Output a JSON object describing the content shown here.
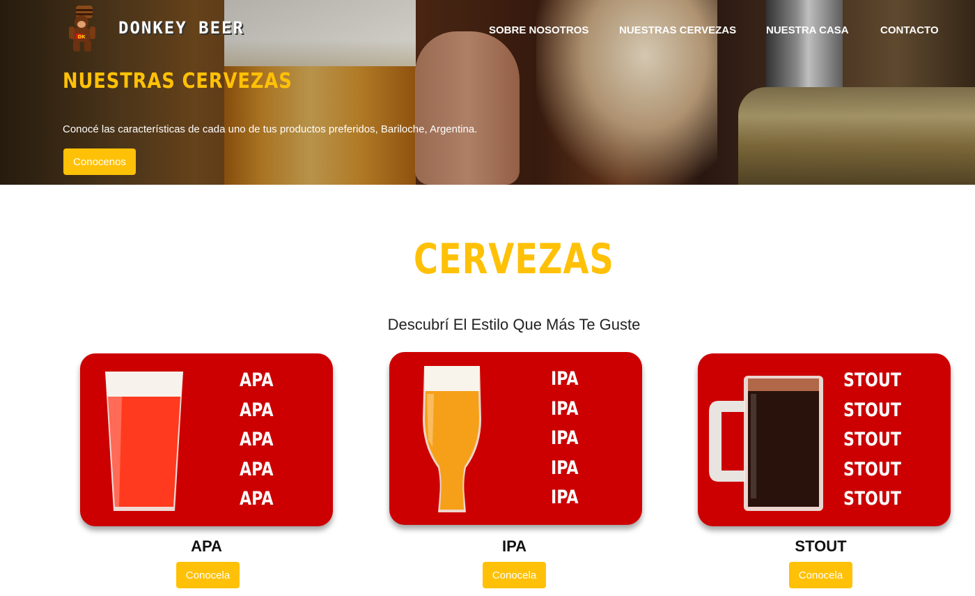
{
  "header": {
    "brand": "DONKEY BEER",
    "nav": [
      "SOBRE NOSOTROS",
      "NUESTRAS CERVEZAS",
      "NUESTRA CASA",
      "CONTACTO"
    ]
  },
  "hero": {
    "title": "NUESTRAS CERVEZAS",
    "text": "Conocé las características de cada uno de tus productos preferidos, Bariloche, Argentina.",
    "button": "Conocenos"
  },
  "section": {
    "title": "CERVEZAS",
    "subtitle": "Descubrí El Estilo Que Más Te Guste"
  },
  "cards": [
    {
      "name": "APA",
      "word": "APA",
      "button": "Conocela",
      "beer_color": "#ff3a1e"
    },
    {
      "name": "IPA",
      "word": "IPA",
      "button": "Conocela",
      "beer_color": "#f6a019"
    },
    {
      "name": "STOUT",
      "word": "STOUT",
      "button": "Conocela",
      "beer_color": "#2a120c"
    }
  ],
  "colors": {
    "accent": "#ffc107",
    "card_red": "#cc0000"
  }
}
